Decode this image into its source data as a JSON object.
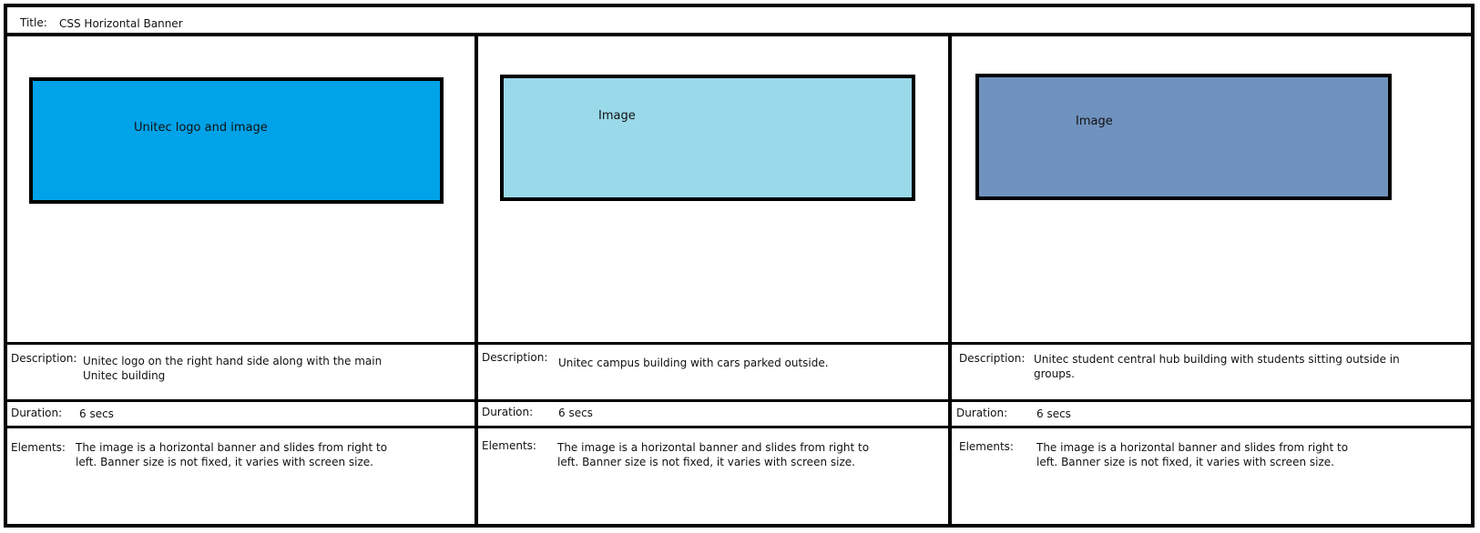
{
  "title": {
    "label": "Title:",
    "value": "CSS Horizontal Banner"
  },
  "field_labels": {
    "description": "Description:",
    "duration": "Duration:",
    "elements": "Elements:"
  },
  "panels": [
    {
      "image_label": "Unitec logo and image",
      "image_color": "#00A2E8",
      "description_lines": [
        "Unitec logo on the right hand side along with the main",
        "Unitec building"
      ],
      "duration": "6 secs",
      "elements_lines": [
        "The image is a horizontal banner and slides from right to",
        "left. Banner size is not fixed, it varies with screen size."
      ]
    },
    {
      "image_label": "Image",
      "image_color": "#99D9EA",
      "description_lines": [
        "Unitec campus building with cars parked outside."
      ],
      "duration": "6 secs",
      "elements_lines": [
        "The image is a horizontal banner and slides from right to",
        "left. Banner size is not fixed, it varies with screen size."
      ]
    },
    {
      "image_label": "Image",
      "image_color": "#7092BE",
      "description_lines": [
        "Unitec student central hub building with students sitting outside in",
        "groups."
      ],
      "duration": "6 secs",
      "elements_lines": [
        "The image is a horizontal banner and slides from right to",
        "left. Banner size is not fixed, it varies with screen size."
      ]
    }
  ]
}
